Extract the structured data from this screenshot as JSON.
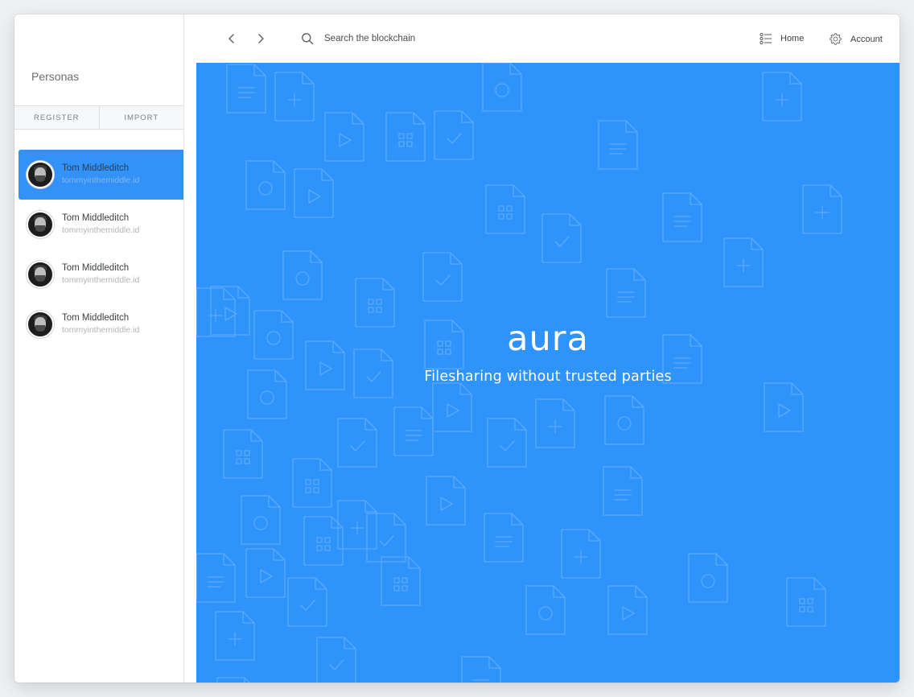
{
  "sidebar": {
    "title": "Personas",
    "register_label": "REGISTER",
    "import_label": "IMPORT",
    "personas": [
      {
        "name": "Tom Middleditch",
        "id": "tommyinthemiddle.id"
      },
      {
        "name": "Tom Middleditch",
        "id": "tommyinthemiddle.id"
      },
      {
        "name": "Tom Middleditch",
        "id": "tommyinthemiddle.id"
      },
      {
        "name": "Tom Middleditch",
        "id": "tommyinthemiddle.id"
      }
    ]
  },
  "topbar": {
    "search_placeholder": "Search the blockchain",
    "home_label": "Home",
    "account_label": "Account"
  },
  "hero": {
    "brand": "aura",
    "tagline": "Filesharing without trusted parties"
  },
  "colors": {
    "accent": "#3392f7",
    "hero_bg": "#2e93fb"
  },
  "icons": [
    "back-icon",
    "forward-icon",
    "search-icon",
    "list-icon",
    "gear-icon"
  ]
}
